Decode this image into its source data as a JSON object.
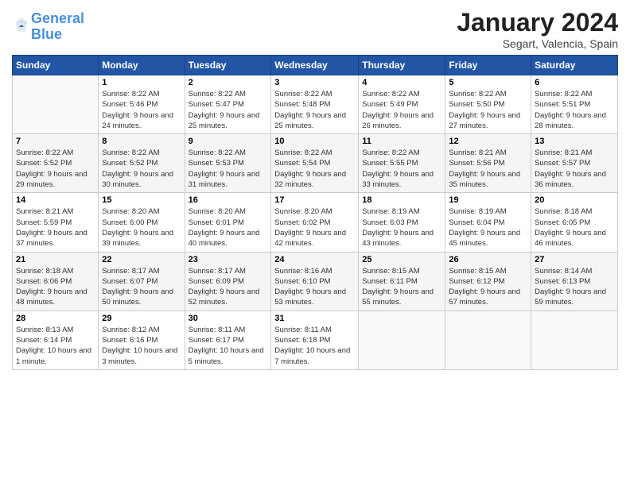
{
  "header": {
    "logo_line1": "General",
    "logo_line2": "Blue",
    "month": "January 2024",
    "location": "Segart, Valencia, Spain"
  },
  "days_of_week": [
    "Sunday",
    "Monday",
    "Tuesday",
    "Wednesday",
    "Thursday",
    "Friday",
    "Saturday"
  ],
  "weeks": [
    [
      {
        "num": "",
        "sunrise": "",
        "sunset": "",
        "daylight": ""
      },
      {
        "num": "1",
        "sunrise": "Sunrise: 8:22 AM",
        "sunset": "Sunset: 5:46 PM",
        "daylight": "Daylight: 9 hours and 24 minutes."
      },
      {
        "num": "2",
        "sunrise": "Sunrise: 8:22 AM",
        "sunset": "Sunset: 5:47 PM",
        "daylight": "Daylight: 9 hours and 25 minutes."
      },
      {
        "num": "3",
        "sunrise": "Sunrise: 8:22 AM",
        "sunset": "Sunset: 5:48 PM",
        "daylight": "Daylight: 9 hours and 25 minutes."
      },
      {
        "num": "4",
        "sunrise": "Sunrise: 8:22 AM",
        "sunset": "Sunset: 5:49 PM",
        "daylight": "Daylight: 9 hours and 26 minutes."
      },
      {
        "num": "5",
        "sunrise": "Sunrise: 8:22 AM",
        "sunset": "Sunset: 5:50 PM",
        "daylight": "Daylight: 9 hours and 27 minutes."
      },
      {
        "num": "6",
        "sunrise": "Sunrise: 8:22 AM",
        "sunset": "Sunset: 5:51 PM",
        "daylight": "Daylight: 9 hours and 28 minutes."
      }
    ],
    [
      {
        "num": "7",
        "sunrise": "Sunrise: 8:22 AM",
        "sunset": "Sunset: 5:52 PM",
        "daylight": "Daylight: 9 hours and 29 minutes."
      },
      {
        "num": "8",
        "sunrise": "Sunrise: 8:22 AM",
        "sunset": "Sunset: 5:52 PM",
        "daylight": "Daylight: 9 hours and 30 minutes."
      },
      {
        "num": "9",
        "sunrise": "Sunrise: 8:22 AM",
        "sunset": "Sunset: 5:53 PM",
        "daylight": "Daylight: 9 hours and 31 minutes."
      },
      {
        "num": "10",
        "sunrise": "Sunrise: 8:22 AM",
        "sunset": "Sunset: 5:54 PM",
        "daylight": "Daylight: 9 hours and 32 minutes."
      },
      {
        "num": "11",
        "sunrise": "Sunrise: 8:22 AM",
        "sunset": "Sunset: 5:55 PM",
        "daylight": "Daylight: 9 hours and 33 minutes."
      },
      {
        "num": "12",
        "sunrise": "Sunrise: 8:21 AM",
        "sunset": "Sunset: 5:56 PM",
        "daylight": "Daylight: 9 hours and 35 minutes."
      },
      {
        "num": "13",
        "sunrise": "Sunrise: 8:21 AM",
        "sunset": "Sunset: 5:57 PM",
        "daylight": "Daylight: 9 hours and 36 minutes."
      }
    ],
    [
      {
        "num": "14",
        "sunrise": "Sunrise: 8:21 AM",
        "sunset": "Sunset: 5:59 PM",
        "daylight": "Daylight: 9 hours and 37 minutes."
      },
      {
        "num": "15",
        "sunrise": "Sunrise: 8:20 AM",
        "sunset": "Sunset: 6:00 PM",
        "daylight": "Daylight: 9 hours and 39 minutes."
      },
      {
        "num": "16",
        "sunrise": "Sunrise: 8:20 AM",
        "sunset": "Sunset: 6:01 PM",
        "daylight": "Daylight: 9 hours and 40 minutes."
      },
      {
        "num": "17",
        "sunrise": "Sunrise: 8:20 AM",
        "sunset": "Sunset: 6:02 PM",
        "daylight": "Daylight: 9 hours and 42 minutes."
      },
      {
        "num": "18",
        "sunrise": "Sunrise: 8:19 AM",
        "sunset": "Sunset: 6:03 PM",
        "daylight": "Daylight: 9 hours and 43 minutes."
      },
      {
        "num": "19",
        "sunrise": "Sunrise: 8:19 AM",
        "sunset": "Sunset: 6:04 PM",
        "daylight": "Daylight: 9 hours and 45 minutes."
      },
      {
        "num": "20",
        "sunrise": "Sunrise: 8:18 AM",
        "sunset": "Sunset: 6:05 PM",
        "daylight": "Daylight: 9 hours and 46 minutes."
      }
    ],
    [
      {
        "num": "21",
        "sunrise": "Sunrise: 8:18 AM",
        "sunset": "Sunset: 6:06 PM",
        "daylight": "Daylight: 9 hours and 48 minutes."
      },
      {
        "num": "22",
        "sunrise": "Sunrise: 8:17 AM",
        "sunset": "Sunset: 6:07 PM",
        "daylight": "Daylight: 9 hours and 50 minutes."
      },
      {
        "num": "23",
        "sunrise": "Sunrise: 8:17 AM",
        "sunset": "Sunset: 6:09 PM",
        "daylight": "Daylight: 9 hours and 52 minutes."
      },
      {
        "num": "24",
        "sunrise": "Sunrise: 8:16 AM",
        "sunset": "Sunset: 6:10 PM",
        "daylight": "Daylight: 9 hours and 53 minutes."
      },
      {
        "num": "25",
        "sunrise": "Sunrise: 8:15 AM",
        "sunset": "Sunset: 6:11 PM",
        "daylight": "Daylight: 9 hours and 55 minutes."
      },
      {
        "num": "26",
        "sunrise": "Sunrise: 8:15 AM",
        "sunset": "Sunset: 6:12 PM",
        "daylight": "Daylight: 9 hours and 57 minutes."
      },
      {
        "num": "27",
        "sunrise": "Sunrise: 8:14 AM",
        "sunset": "Sunset: 6:13 PM",
        "daylight": "Daylight: 9 hours and 59 minutes."
      }
    ],
    [
      {
        "num": "28",
        "sunrise": "Sunrise: 8:13 AM",
        "sunset": "Sunset: 6:14 PM",
        "daylight": "Daylight: 10 hours and 1 minute."
      },
      {
        "num": "29",
        "sunrise": "Sunrise: 8:12 AM",
        "sunset": "Sunset: 6:16 PM",
        "daylight": "Daylight: 10 hours and 3 minutes."
      },
      {
        "num": "30",
        "sunrise": "Sunrise: 8:11 AM",
        "sunset": "Sunset: 6:17 PM",
        "daylight": "Daylight: 10 hours and 5 minutes."
      },
      {
        "num": "31",
        "sunrise": "Sunrise: 8:11 AM",
        "sunset": "Sunset: 6:18 PM",
        "daylight": "Daylight: 10 hours and 7 minutes."
      },
      {
        "num": "",
        "sunrise": "",
        "sunset": "",
        "daylight": ""
      },
      {
        "num": "",
        "sunrise": "",
        "sunset": "",
        "daylight": ""
      },
      {
        "num": "",
        "sunrise": "",
        "sunset": "",
        "daylight": ""
      }
    ]
  ]
}
